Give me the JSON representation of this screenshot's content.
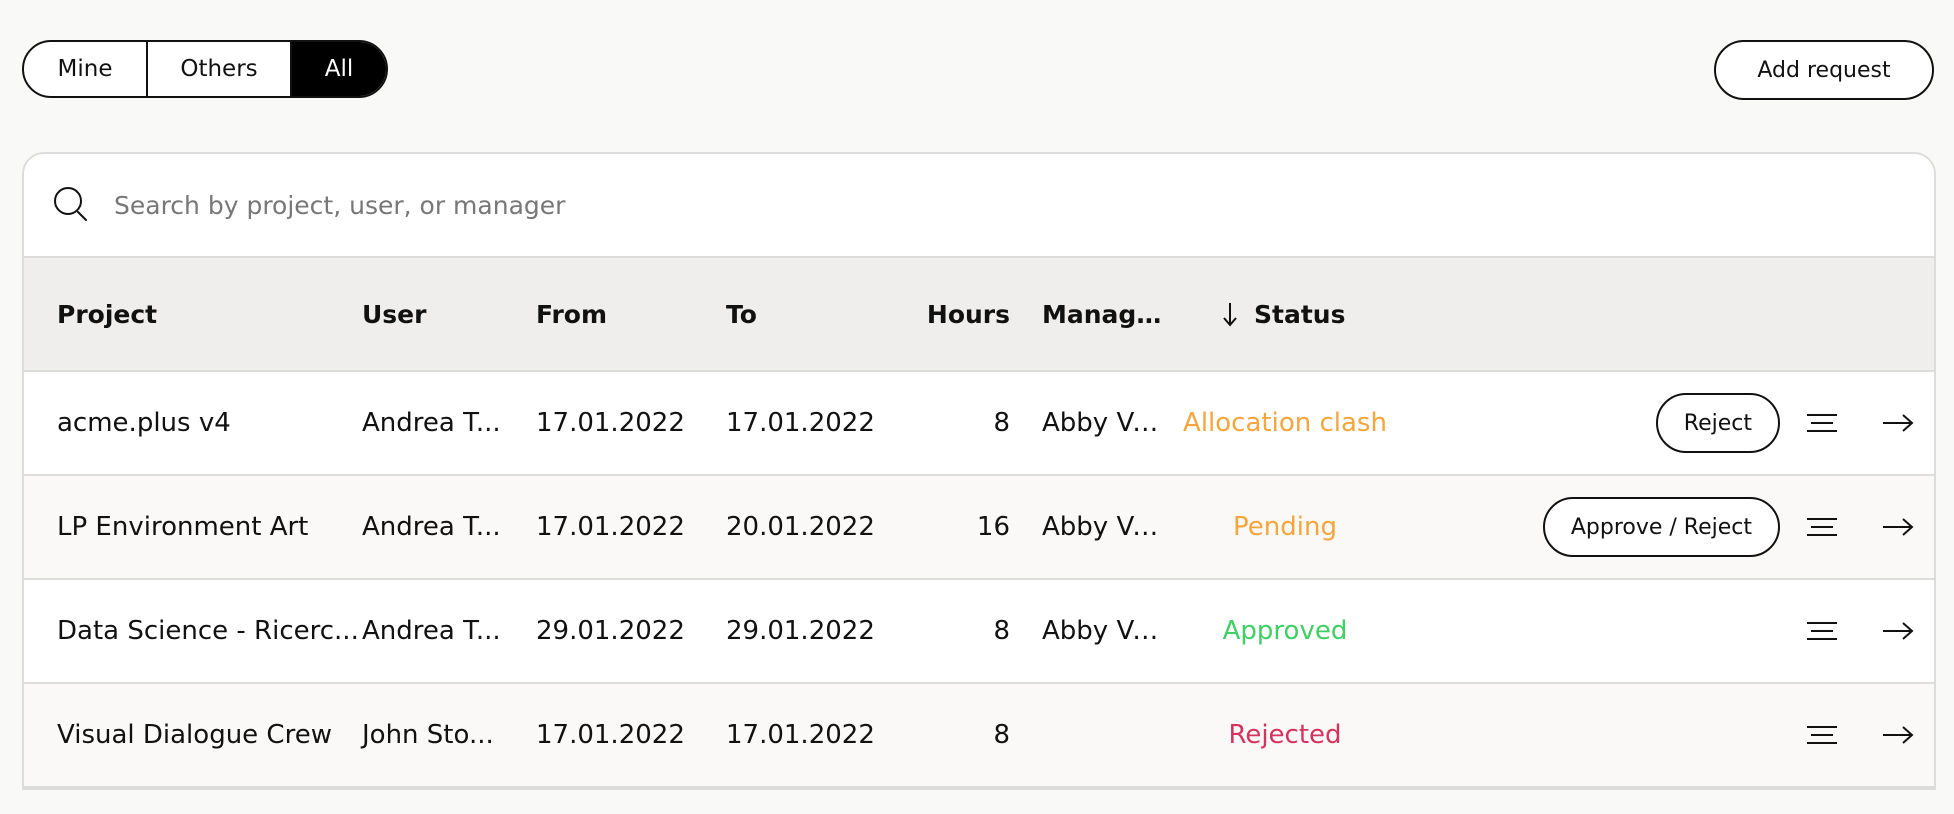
{
  "filters": {
    "options": [
      "Mine",
      "Others",
      "All"
    ],
    "selected": "All"
  },
  "add_request_label": "Add request",
  "search": {
    "placeholder": "Search by project, user, or manager",
    "value": ""
  },
  "table": {
    "columns": {
      "project": "Project",
      "user": "User",
      "from": "From",
      "to": "To",
      "hours": "Hours",
      "manager": "Manager",
      "status": "Status"
    },
    "sort": {
      "column": "Status",
      "direction": "descending"
    },
    "rows": [
      {
        "project": "acme.plus v4",
        "user": "Andrea T...",
        "from": "17.01.2022",
        "to": "17.01.2022",
        "hours": "8",
        "manager": "Abby Vari...",
        "status": "Allocation clash",
        "action": "Reject"
      },
      {
        "project": "LP Environment Art",
        "user": "Andrea T...",
        "from": "17.01.2022",
        "to": "20.01.2022",
        "hours": "16",
        "manager": "Abby Vari...",
        "status": "Pending",
        "action": "Approve / Reject"
      },
      {
        "project": "Data Science - Ricerc...",
        "user": "Andrea T...",
        "from": "29.01.2022",
        "to": "29.01.2022",
        "hours": "8",
        "manager": "Abby Vari...",
        "status": "Approved",
        "action": ""
      },
      {
        "project": "Visual Dialogue Crew",
        "user": "John Sto...",
        "from": "17.01.2022",
        "to": "17.01.2022",
        "hours": "8",
        "manager": "",
        "status": "Rejected",
        "action": ""
      }
    ]
  },
  "colors": {
    "Allocation clash": "#f5a53b",
    "Pending": "#f5a53b",
    "Approved": "#3fcf64",
    "Rejected": "#d6325e",
    "accent": "#000000"
  },
  "icons": {
    "search": "search-icon",
    "sort": "arrow-down-icon",
    "row_menu": "lines-icon",
    "row_open": "arrow-right-icon"
  }
}
